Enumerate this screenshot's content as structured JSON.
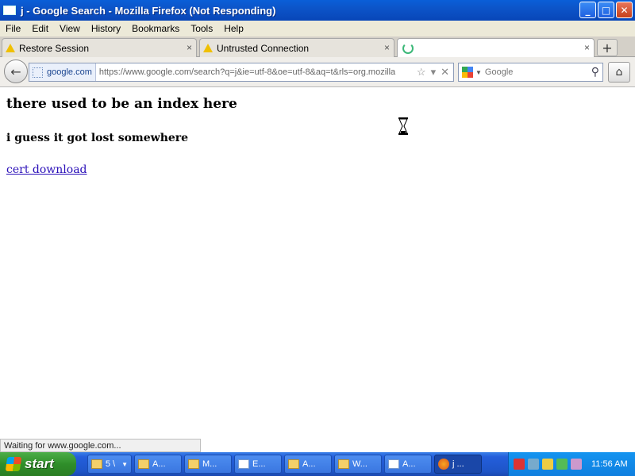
{
  "window": {
    "title": "j - Google Search - Mozilla Firefox (Not Responding)",
    "controls": {
      "minimize": "_",
      "maximize": "□",
      "close": "✕"
    }
  },
  "menu": [
    "File",
    "Edit",
    "View",
    "History",
    "Bookmarks",
    "Tools",
    "Help"
  ],
  "tabs": [
    {
      "label": "Restore Session",
      "icon": "warning-icon"
    },
    {
      "label": "Untrusted Connection",
      "icon": "warning-icon"
    },
    {
      "label": "",
      "icon": "loading-spinner-icon"
    }
  ],
  "tab_close_glyph": "×",
  "new_tab_glyph": "+",
  "nav": {
    "identity": "google.com",
    "url": "https://www.google.com/search?q=j&ie=utf-8&oe=utf-8&aq=t&rls=org.mozilla",
    "search_placeholder": "Google"
  },
  "page": {
    "heading": "there used to be an index here",
    "subheading": "i guess it got lost somewhere",
    "link": "cert download"
  },
  "status": "Waiting for www.google.com...",
  "taskbar": {
    "start": "start",
    "tasks": [
      {
        "label": "5 \\",
        "icon": "folder"
      },
      {
        "label": "A...",
        "icon": "folder"
      },
      {
        "label": "M...",
        "icon": "app"
      },
      {
        "label": "E...",
        "icon": "window"
      },
      {
        "label": "A...",
        "icon": "app"
      },
      {
        "label": "W...",
        "icon": "app"
      },
      {
        "label": "A...",
        "icon": "window"
      },
      {
        "label": "j ...",
        "icon": "firefox"
      }
    ],
    "clock": "11:56 AM"
  }
}
